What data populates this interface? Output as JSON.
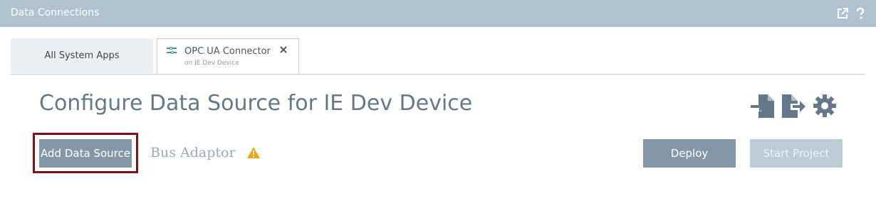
{
  "window": {
    "title": "Data Connections",
    "icons": [
      "external-link-icon",
      "help-icon"
    ]
  },
  "tabs": [
    {
      "label": "All System Apps",
      "active": false
    },
    {
      "label": "OPC UA Connector",
      "sublabel": "on IE Dev Device",
      "active": true,
      "icon": "connector-icon",
      "closable": true
    }
  ],
  "main": {
    "title": "Configure Data Source for IE Dev Device",
    "actions": [
      "import-icon",
      "export-icon",
      "settings-icon"
    ],
    "add_button": "Add Data Source",
    "adaptor_label": "Bus Adaptor",
    "deploy_button": "Deploy",
    "start_button": "Start Project"
  },
  "colors": {
    "titlebar": "#b0c2cd",
    "primary_button": "#8397a7",
    "disabled_button": "#bcccd7",
    "highlight_border": "#7d1216",
    "warning": "#f0a30a"
  }
}
